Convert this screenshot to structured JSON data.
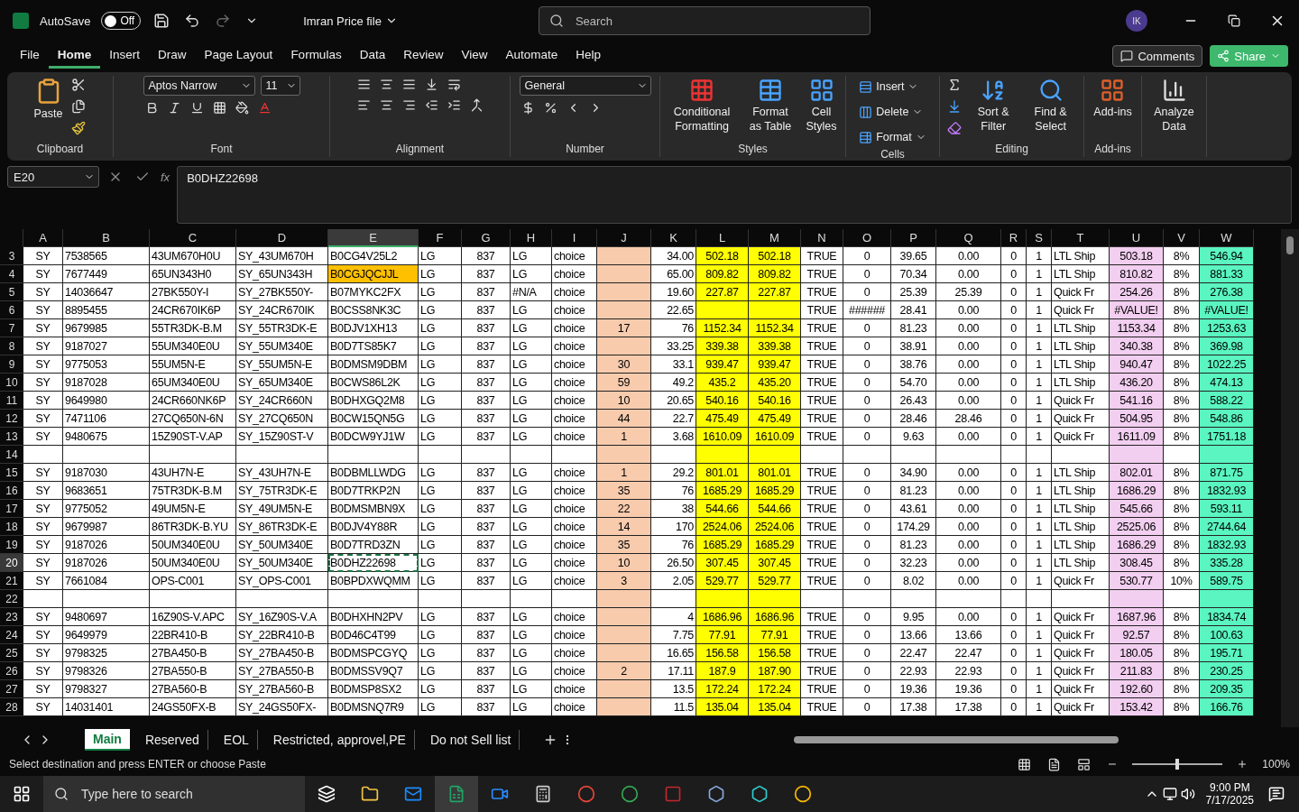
{
  "title_bar": {
    "autosave": {
      "label": "AutoSave",
      "on": false,
      "state_text": "Off"
    },
    "file_name": "Imran Price file",
    "search": {
      "placeholder": "Search"
    },
    "avatar": "IK"
  },
  "menu_tabs": [
    {
      "label": "File",
      "selected": false
    },
    {
      "label": "Home",
      "selected": true
    },
    {
      "label": "Insert",
      "selected": false
    },
    {
      "label": "Draw",
      "selected": false
    },
    {
      "label": "Page Layout",
      "selected": false
    },
    {
      "label": "Formulas",
      "selected": false
    },
    {
      "label": "Data",
      "selected": false
    },
    {
      "label": "Review",
      "selected": false
    },
    {
      "label": "View",
      "selected": false
    },
    {
      "label": "Automate",
      "selected": false
    },
    {
      "label": "Help",
      "selected": false
    }
  ],
  "header_buttons": {
    "comments": "Comments",
    "share": "Share"
  },
  "ribbon": {
    "clipboard": {
      "label": "Clipboard",
      "paste": "Paste"
    },
    "font": {
      "label": "Font",
      "font_name": "Aptos Narrow",
      "font_size": "11"
    },
    "alignment": {
      "label": "Alignment"
    },
    "number": {
      "label": "Number",
      "format": "General"
    },
    "styles": {
      "label": "Styles",
      "buttons": [
        "Conditional Formatting",
        "Format as Table",
        "Cell Styles"
      ]
    },
    "cells": {
      "label": "Cells",
      "buttons": [
        "Insert",
        "Delete",
        "Format"
      ]
    },
    "editing": {
      "label": "Editing",
      "buttons": [
        "Sort & Filter",
        "Find & Select"
      ]
    },
    "addins": {
      "label": "Add-ins",
      "buttons": [
        "Add-ins"
      ]
    },
    "analyze": {
      "buttons": [
        "Analyze Data"
      ]
    }
  },
  "formula_bar": {
    "name_box": "E20",
    "fx_label": "fx",
    "formula": "B0DHZ22698"
  },
  "columns": [
    {
      "label": "A",
      "selected": false
    },
    {
      "label": "B",
      "selected": false
    },
    {
      "label": "C",
      "selected": false
    },
    {
      "label": "D",
      "selected": false
    },
    {
      "label": "E",
      "selected": true
    },
    {
      "label": "F",
      "selected": false
    },
    {
      "label": "G",
      "selected": false
    },
    {
      "label": "H",
      "selected": false
    },
    {
      "label": "I",
      "selected": false
    },
    {
      "label": "J",
      "selected": false,
      "color": "#f8cbad"
    },
    {
      "label": "K",
      "selected": false
    },
    {
      "label": "L",
      "selected": false,
      "color": "#ffff00"
    },
    {
      "label": "M",
      "selected": false,
      "color": "#ffff00"
    },
    {
      "label": "N",
      "selected": false
    },
    {
      "label": "O",
      "selected": false
    },
    {
      "label": "P",
      "selected": false
    },
    {
      "label": "Q",
      "selected": false
    },
    {
      "label": "R",
      "selected": false
    },
    {
      "label": "S",
      "selected": false
    },
    {
      "label": "T",
      "selected": false
    },
    {
      "label": "U",
      "selected": false,
      "color": "#f2cef0"
    },
    {
      "label": "V",
      "selected": false
    },
    {
      "label": "W",
      "selected": false,
      "color": "#5af5c0"
    }
  ],
  "rows": [
    {
      "header": "3",
      "selected": false,
      "cells": [
        "SY",
        "7538565",
        "43UM670H0U",
        "SY_43UM670H",
        "B0CG4V25L2",
        "LG",
        "837",
        "LG",
        "choice",
        null,
        "34.00",
        "502.18",
        "502.18",
        "TRUE",
        "0",
        "39.65",
        "0.00",
        "0",
        "1",
        "LTL Ship",
        "503.18",
        "8%",
        "546.94"
      ]
    },
    {
      "header": "4",
      "selected": false,
      "cells": [
        "SY",
        "7677449",
        "65UN343H0",
        "SY_65UN343H",
        {
          "text": "B0CGJQCJJL",
          "color": "#ffc000"
        },
        "LG",
        "837",
        "LG",
        "choice",
        null,
        "65.00",
        "809.82",
        "809.82",
        "TRUE",
        "0",
        "70.34",
        "0.00",
        "0",
        "1",
        "LTL Ship",
        "810.82",
        "8%",
        "881.33"
      ]
    },
    {
      "header": "5",
      "selected": false,
      "cells": [
        "SY",
        "14036647",
        "27BK550Y-I",
        "SY_27BK550Y-",
        "B07MYKC2FX",
        "LG",
        "837",
        "#N/A",
        "choice",
        null,
        "19.60",
        "227.87",
        "227.87",
        "TRUE",
        "0",
        "25.39",
        "25.39",
        "0",
        "1",
        "Quick Fr",
        "254.26",
        "8%",
        "276.38"
      ]
    },
    {
      "header": "6",
      "selected": false,
      "cells": [
        "SY",
        "8895455",
        "24CR670IK6P",
        "SY_24CR670IK",
        "B0CSS8NK3C",
        "LG",
        "837",
        "LG",
        "choice",
        null,
        "22.65",
        null,
        null,
        "TRUE",
        "######",
        "28.41",
        "0.00",
        "0",
        "1",
        "Quick Fr",
        "#VALUE!",
        "8%",
        "#VALUE!"
      ]
    },
    {
      "header": "7",
      "selected": false,
      "cells": [
        "SY",
        "9679985",
        "55TR3DK-B.M",
        "SY_55TR3DK-E",
        "B0DJV1XH13",
        "LG",
        "837",
        "LG",
        "choice",
        "17",
        "76",
        "1152.34",
        "1152.34",
        "TRUE",
        "0",
        "81.23",
        "0.00",
        "0",
        "1",
        "LTL Ship",
        "1153.34",
        "8%",
        "1253.63"
      ]
    },
    {
      "header": "8",
      "selected": false,
      "cells": [
        "SY",
        "9187027",
        "55UM340E0U",
        "SY_55UM340E",
        "B0D7TS85K7",
        "LG",
        "837",
        "LG",
        "choice",
        null,
        "33.25",
        "339.38",
        "339.38",
        "TRUE",
        "0",
        "38.91",
        "0.00",
        "0",
        "1",
        "LTL Ship",
        "340.38",
        "8%",
        "369.98"
      ]
    },
    {
      "header": "9",
      "selected": false,
      "cells": [
        "SY",
        "9775053",
        "55UM5N-E",
        "SY_55UM5N-E",
        "B0DMSM9DBM",
        "LG",
        "837",
        "LG",
        "choice",
        "30",
        "33.1",
        "939.47",
        "939.47",
        "TRUE",
        "0",
        "38.76",
        "0.00",
        "0",
        "1",
        "LTL Ship",
        "940.47",
        "8%",
        "1022.25"
      ]
    },
    {
      "header": "10",
      "selected": false,
      "cells": [
        "SY",
        "9187028",
        "65UM340E0U",
        "SY_65UM340E",
        "B0CWS86L2K",
        "LG",
        "837",
        "LG",
        "choice",
        "59",
        "49.2",
        "435.2",
        "435.20",
        "TRUE",
        "0",
        "54.70",
        "0.00",
        "0",
        "1",
        "LTL Ship",
        "436.20",
        "8%",
        "474.13"
      ]
    },
    {
      "header": "11",
      "selected": false,
      "cells": [
        "SY",
        "9649980",
        "24CR660NK6P",
        "SY_24CR660N",
        "B0DHXGQ2M8",
        "LG",
        "837",
        "LG",
        "choice",
        "10",
        "20.65",
        "540.16",
        "540.16",
        "TRUE",
        "0",
        "26.43",
        "0.00",
        "0",
        "1",
        "Quick Fr",
        "541.16",
        "8%",
        "588.22"
      ]
    },
    {
      "header": "12",
      "selected": false,
      "cells": [
        "SY",
        "7471106",
        "27CQ650N-6N",
        "SY_27CQ650N",
        "B0CW15QN5G",
        "LG",
        "837",
        "LG",
        "choice",
        "44",
        "22.7",
        "475.49",
        "475.49",
        "TRUE",
        "0",
        "28.46",
        "28.46",
        "0",
        "1",
        "Quick Fr",
        "504.95",
        "8%",
        "548.86"
      ]
    },
    {
      "header": "13",
      "selected": false,
      "cells": [
        "SY",
        "9480675",
        "15Z90ST-V.AP",
        "SY_15Z90ST-V",
        "B0DCW9YJ1W",
        "LG",
        "837",
        "LG",
        "choice",
        "1",
        "3.68",
        "1610.09",
        "1610.09",
        "TRUE",
        "0",
        "9.63",
        "0.00",
        "0",
        "1",
        "Quick Fr",
        "1611.09",
        "8%",
        "1751.18"
      ]
    },
    {
      "header": "14",
      "selected": false
    },
    {
      "header": "15",
      "selected": false,
      "cells": [
        "SY",
        "9187030",
        "43UH7N-E",
        "SY_43UH7N-E",
        "B0DBMLLWDG",
        "LG",
        "837",
        "LG",
        "choice",
        "1",
        "29.2",
        "801.01",
        "801.01",
        "TRUE",
        "0",
        "34.90",
        "0.00",
        "0",
        "1",
        "LTL Ship",
        "802.01",
        "8%",
        "871.75"
      ]
    },
    {
      "header": "16",
      "selected": false,
      "cells": [
        "SY",
        "9683651",
        "75TR3DK-B.M",
        "SY_75TR3DK-E",
        "B0D7TRKP2N",
        "LG",
        "837",
        "LG",
        "choice",
        "35",
        "76",
        "1685.29",
        "1685.29",
        "TRUE",
        "0",
        "81.23",
        "0.00",
        "0",
        "1",
        "LTL Ship",
        "1686.29",
        "8%",
        "1832.93"
      ]
    },
    {
      "header": "17",
      "selected": false,
      "cells": [
        "SY",
        "9775052",
        "49UM5N-E",
        "SY_49UM5N-E",
        "B0DMSMBN9X",
        "LG",
        "837",
        "LG",
        "choice",
        "22",
        "38",
        "544.66",
        "544.66",
        "TRUE",
        "0",
        "43.61",
        "0.00",
        "0",
        "1",
        "LTL Ship",
        "545.66",
        "8%",
        "593.11"
      ]
    },
    {
      "header": "18",
      "selected": false,
      "cells": [
        "SY",
        "9679987",
        "86TR3DK-B.YU",
        "SY_86TR3DK-E",
        "B0DJV4Y88R",
        "LG",
        "837",
        "LG",
        "choice",
        "14",
        "170",
        "2524.06",
        "2524.06",
        "TRUE",
        "0",
        "174.29",
        "0.00",
        "0",
        "1",
        "LTL Ship",
        "2525.06",
        "8%",
        "2744.64"
      ]
    },
    {
      "header": "19",
      "selected": false,
      "cells": [
        "SY",
        "9187026",
        "50UM340E0U",
        "SY_50UM340E",
        "B0D7TRD3ZN",
        "LG",
        "837",
        "LG",
        "choice",
        "35",
        "76",
        "1685.29",
        "1685.29",
        "TRUE",
        "0",
        "81.23",
        "0.00",
        "0",
        "1",
        "LTL Ship",
        "1686.29",
        "8%",
        "1832.93"
      ]
    },
    {
      "header": "20",
      "selected": true,
      "cells": [
        "SY",
        "9187026",
        "50UM340E0U",
        "SY_50UM340E",
        {
          "text": "B0DHZ22698",
          "selected": true
        },
        "LG",
        "837",
        "LG",
        "choice",
        "10",
        "26.50",
        "307.45",
        "307.45",
        "TRUE",
        "0",
        "32.23",
        "0.00",
        "0",
        "1",
        "LTL Ship",
        "308.45",
        "8%",
        "335.28"
      ]
    },
    {
      "header": "21",
      "selected": false,
      "cells": [
        "SY",
        "7661084",
        "OPS-C001",
        "SY_OPS-C001",
        "B0BPDXWQMM",
        "LG",
        "837",
        "LG",
        "choice",
        "3",
        "2.05",
        "529.77",
        "529.77",
        "TRUE",
        "0",
        "8.02",
        "0.00",
        "0",
        "1",
        "Quick Fr",
        "530.77",
        "10%",
        "589.75"
      ]
    },
    {
      "header": "22",
      "selected": false
    },
    {
      "header": "23",
      "selected": false,
      "cells": [
        "SY",
        "9480697",
        "16Z90S-V.APC",
        "SY_16Z90S-V.A",
        "B0DHXHN2PV",
        "LG",
        "837",
        "LG",
        "choice",
        null,
        "4",
        "1686.96",
        "1686.96",
        "TRUE",
        "0",
        "9.95",
        "0.00",
        "0",
        "1",
        "Quick Fr",
        "1687.96",
        "8%",
        "1834.74"
      ]
    },
    {
      "header": "24",
      "selected": false,
      "cells": [
        "SY",
        "9649979",
        "22BR410-B",
        "SY_22BR410-B",
        "B0D46C4T99",
        "LG",
        "837",
        "LG",
        "choice",
        null,
        "7.75",
        "77.91",
        "77.91",
        "TRUE",
        "0",
        "13.66",
        "13.66",
        "0",
        "1",
        "Quick Fr",
        "92.57",
        "8%",
        "100.63"
      ]
    },
    {
      "header": "25",
      "selected": false,
      "cells": [
        "SY",
        "9798325",
        "27BA450-B",
        "SY_27BA450-B",
        "B0DMSPCGYQ",
        "LG",
        "837",
        "LG",
        "choice",
        null,
        "16.65",
        "156.58",
        "156.58",
        "TRUE",
        "0",
        "22.47",
        "22.47",
        "0",
        "1",
        "Quick Fr",
        "180.05",
        "8%",
        "195.71"
      ]
    },
    {
      "header": "26",
      "selected": false,
      "cells": [
        "SY",
        "9798326",
        "27BA550-B",
        "SY_27BA550-B",
        "B0DMSSV9Q7",
        "LG",
        "837",
        "LG",
        "choice",
        "2",
        "17.11",
        "187.9",
        "187.90",
        "TRUE",
        "0",
        "22.93",
        "22.93",
        "0",
        "1",
        "Quick Fr",
        "211.83",
        "8%",
        "230.25"
      ]
    },
    {
      "header": "27",
      "selected": false,
      "cells": [
        "SY",
        "9798327",
        "27BA560-B",
        "SY_27BA560-B",
        "B0DMSP8SX2",
        "LG",
        "837",
        "LG",
        "choice",
        null,
        "13.5",
        "172.24",
        "172.24",
        "TRUE",
        "0",
        "19.36",
        "19.36",
        "0",
        "1",
        "Quick Fr",
        "192.60",
        "8%",
        "209.35"
      ]
    },
    {
      "header": "28",
      "selected": false,
      "cells": [
        "SY",
        "14031401",
        "24GS50FX-B",
        "SY_24GS50FX-",
        "B0DMSNQ7R9",
        "LG",
        "837",
        "LG",
        "choice",
        null,
        "11.5",
        "135.04",
        "135.04",
        "TRUE",
        "0",
        "17.38",
        "17.38",
        "0",
        "1",
        "Quick Fr",
        "153.42",
        "8%",
        "166.76"
      ]
    }
  ],
  "sheet_tabs": [
    {
      "label": "Main",
      "selected": true
    },
    {
      "label": "Reserved",
      "selected": false
    },
    {
      "label": "EOL",
      "selected": false
    },
    {
      "label": "Restricted, approvel,PE",
      "selected": false
    },
    {
      "label": "Do not Sell list",
      "selected": false
    }
  ],
  "status_bar": {
    "message": "Select destination and press ENTER or choose Paste",
    "zoom": {
      "level": 0.5,
      "reading": "100%"
    }
  },
  "taskbar": {
    "search": {
      "placeholder": "Type here to search"
    },
    "time": "9:00 PM",
    "date": "7/17/2025"
  }
}
